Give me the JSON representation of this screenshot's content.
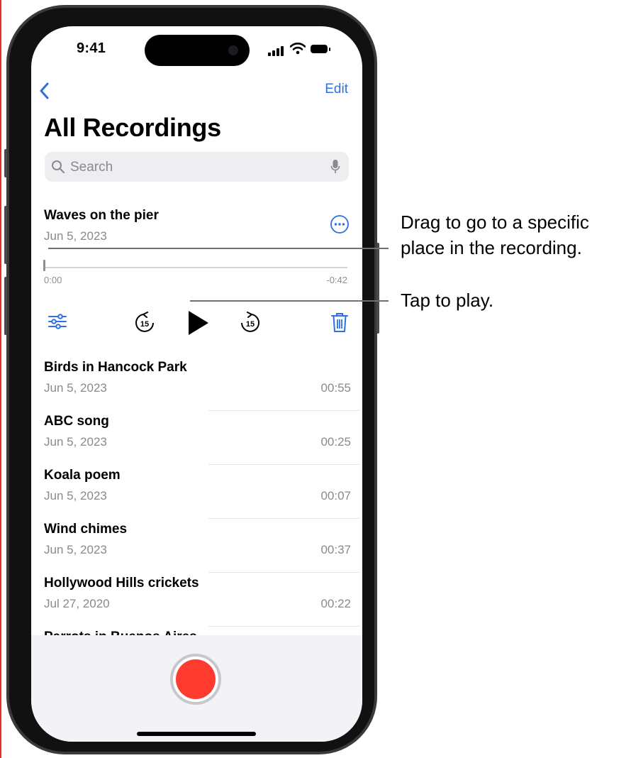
{
  "status_bar": {
    "time": "9:41"
  },
  "nav": {
    "edit_label": "Edit"
  },
  "page": {
    "title": "All Recordings"
  },
  "search": {
    "placeholder": "Search"
  },
  "current_recording": {
    "title": "Waves on the pier",
    "date": "Jun 5, 2023",
    "elapsed": "0:00",
    "remaining": "-0:42",
    "progress": 0.0
  },
  "controls": {
    "skip_back_seconds": "15",
    "skip_forward_seconds": "15"
  },
  "recordings": [
    {
      "name": "Birds in Hancock Park",
      "date": "Jun 5, 2023",
      "duration": "00:55"
    },
    {
      "name": "ABC song",
      "date": "Jun 5, 2023",
      "duration": "00:25"
    },
    {
      "name": "Koala poem",
      "date": "Jun 5, 2023",
      "duration": "00:07"
    },
    {
      "name": "Wind chimes",
      "date": "Jun 5, 2023",
      "duration": "00:37"
    },
    {
      "name": "Hollywood Hills crickets",
      "date": "Jul 27, 2020",
      "duration": "00:22"
    },
    {
      "name": "Parrots in Buenos Aires",
      "date": "",
      "duration": ""
    }
  ],
  "callouts": {
    "scrubber_line1": "Drag to go to a specific",
    "scrubber_line2": "place in the recording.",
    "play": "Tap to play."
  },
  "colors": {
    "accent": "#2f6fe0",
    "record": "#ff3b30",
    "secondary_text": "#8a8a8e",
    "edge_line": "#e0302a"
  },
  "icons": [
    "chevron-left-icon",
    "search-icon",
    "mic-icon",
    "more-icon",
    "equalizer-icon",
    "skip-back-15-icon",
    "play-icon",
    "skip-forward-15-icon",
    "trash-icon",
    "record-icon"
  ]
}
